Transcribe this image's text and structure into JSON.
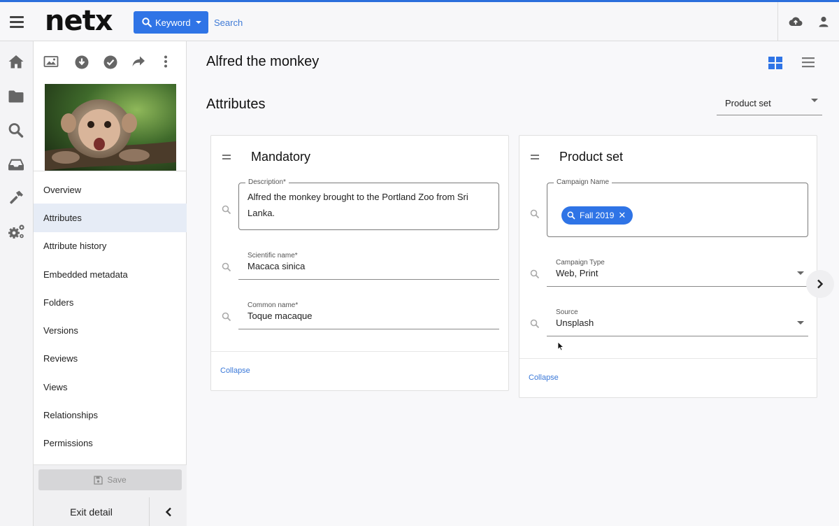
{
  "header": {
    "logo": "netx",
    "search_mode": "Keyword",
    "search_placeholder": "Search"
  },
  "left_nav": [
    "home-icon",
    "folder-icon",
    "search-icon",
    "inbox-icon",
    "hammer-icon",
    "settings-icon"
  ],
  "detail_panel": {
    "toolbar_icons": [
      "image-icon",
      "download-icon",
      "approve-icon",
      "share-icon",
      "more-icon"
    ],
    "menu": [
      {
        "label": "Overview"
      },
      {
        "label": "Attributes",
        "active": true
      },
      {
        "label": "Attribute history"
      },
      {
        "label": "Embedded metadata"
      },
      {
        "label": "Folders"
      },
      {
        "label": "Versions"
      },
      {
        "label": "Reviews"
      },
      {
        "label": "Views"
      },
      {
        "label": "Relationships"
      },
      {
        "label": "Permissions"
      }
    ],
    "save_label": "Save",
    "exit_label": "Exit detail"
  },
  "main": {
    "asset_title": "Alfred the monkey",
    "section_title": "Attributes",
    "set_selector": "Product set"
  },
  "mandatory_card": {
    "title": "Mandatory",
    "description_label": "Description*",
    "description_value": "Alfred the monkey brought to the Portland Zoo from Sri Lanka.",
    "scientific_label": "Scientific name*",
    "scientific_value": "Macaca sinica",
    "common_label": "Common name*",
    "common_value": "Toque macaque",
    "collapse": "Collapse"
  },
  "product_card": {
    "title": "Product set",
    "campaign_name_label": "Campaign Name",
    "campaign_chip": "Fall 2019",
    "campaign_type_label": "Campaign Type",
    "campaign_type_value": "Web, Print",
    "source_label": "Source",
    "source_value": "Unsplash",
    "collapse": "Collapse"
  },
  "colors": {
    "accent": "#2f74e6",
    "active_menu_bg": "#e6ecf6",
    "link": "#3a78d8"
  }
}
